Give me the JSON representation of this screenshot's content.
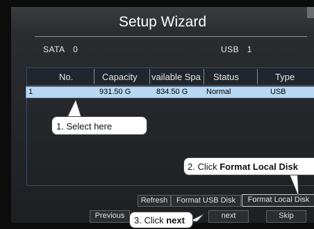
{
  "window": {
    "title": "Setup Wizard"
  },
  "info": {
    "sata_label": "SATA",
    "sata_value": "0",
    "usb_label": "USB",
    "usb_value": "1"
  },
  "table": {
    "headers": {
      "no": "No.",
      "capacity": "Capacity",
      "available": "vailable Spa",
      "status": "Status",
      "type": "Type"
    },
    "rows": [
      {
        "no": "1",
        "capacity": "931.50 G",
        "available": "834.50 G",
        "status": "Normal",
        "type": "USB"
      }
    ]
  },
  "buttons": {
    "refresh": "Refresh",
    "format_usb": "Format USB Disk",
    "format_local": "Format Local Disk",
    "previous": "Previous",
    "next": "next",
    "skip": "Skip"
  },
  "annotations": {
    "step1": "1. Select here",
    "step2_prefix": "2. Click ",
    "step2_bold": "Format Local Disk",
    "step3_prefix": "3. Click ",
    "step3_bold": "next"
  },
  "colors": {
    "selected_row": "#b8d8f2",
    "window_bg": "#1d1f22"
  }
}
